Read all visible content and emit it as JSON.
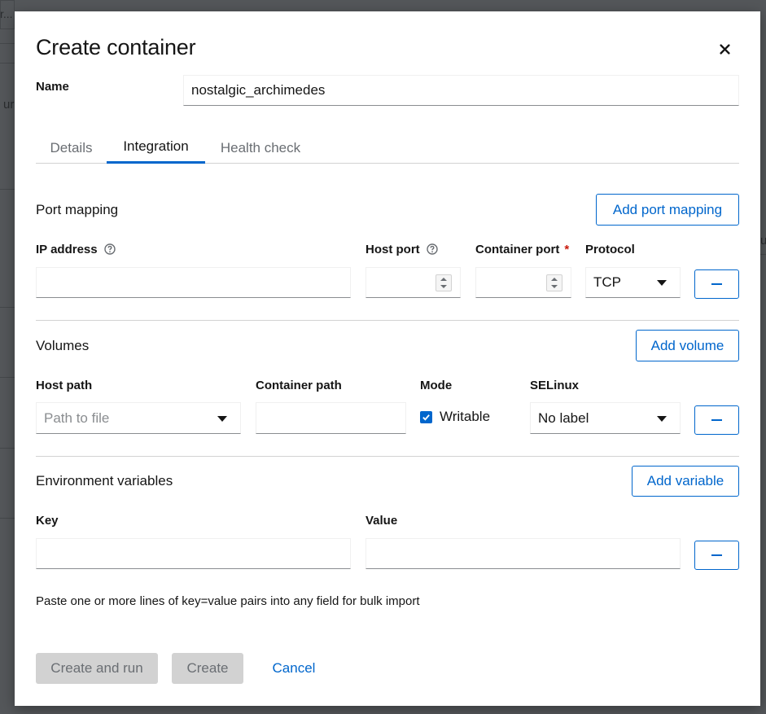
{
  "backdrop": {
    "fragment_1": "r...",
    "fragment_2": "ur",
    "fragment_3": "u"
  },
  "dialog": {
    "title": "Create container",
    "close_icon": "close-icon",
    "name_label": "Name",
    "name_value": "nostalgic_archimedes",
    "tabs": [
      {
        "label": "Details",
        "active": false
      },
      {
        "label": "Integration",
        "active": true
      },
      {
        "label": "Health check",
        "active": false
      }
    ],
    "port_mapping": {
      "heading": "Port mapping",
      "add_label": "Add port mapping",
      "ip_label": "IP address",
      "host_port_label": "Host port",
      "container_port_label": "Container port",
      "required_marker": "*",
      "protocol_label": "Protocol",
      "ip_value": "",
      "host_port_value": "",
      "container_port_value": "",
      "protocol_value": "TCP",
      "help_icon": "help-circle-icon",
      "remove_icon": "minus-icon"
    },
    "volumes": {
      "heading": "Volumes",
      "add_label": "Add volume",
      "host_path_label": "Host path",
      "container_path_label": "Container path",
      "mode_label": "Mode",
      "selinux_label": "SELinux",
      "host_path_placeholder": "Path to file",
      "container_path_value": "",
      "writable_label": "Writable",
      "writable_checked": true,
      "selinux_value": "No label",
      "remove_icon": "minus-icon"
    },
    "env": {
      "heading": "Environment variables",
      "add_label": "Add variable",
      "key_label": "Key",
      "value_label": "Value",
      "key_value": "",
      "value_value": "",
      "remove_icon": "minus-icon",
      "helper_text": "Paste one or more lines of key=value pairs into any field for bulk import"
    },
    "footer": {
      "create_and_run": "Create and run",
      "create": "Create",
      "cancel": "Cancel"
    },
    "colors": {
      "accent": "#0066cc",
      "required": "#c9190b",
      "disabled_bg": "#d2d2d2"
    }
  }
}
